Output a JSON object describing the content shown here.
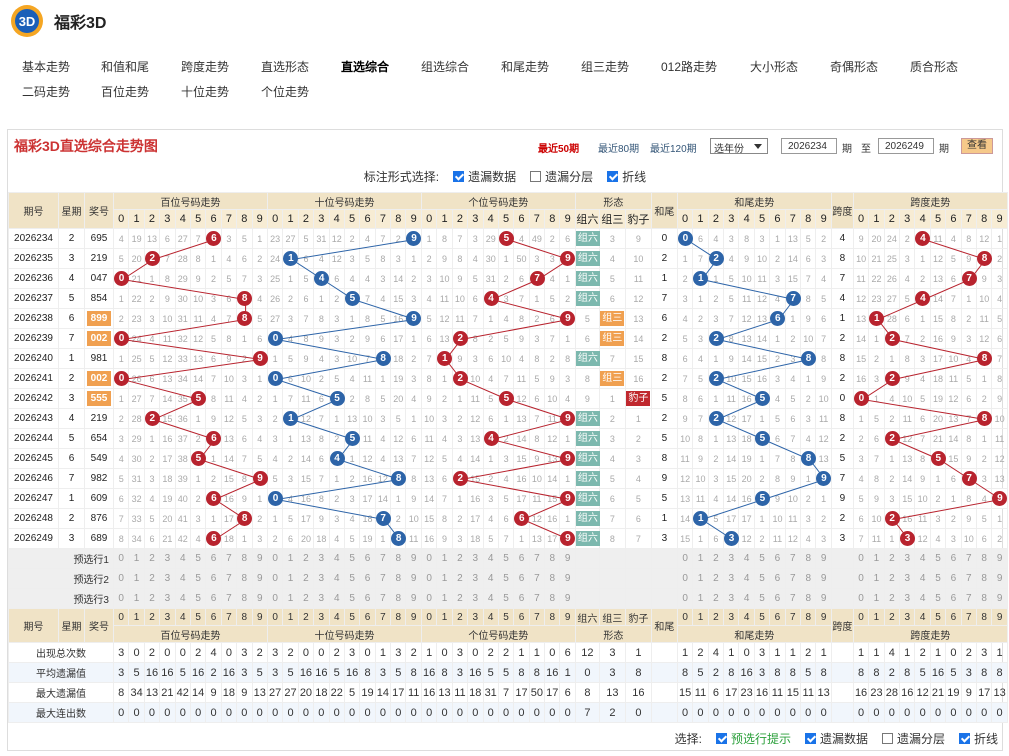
{
  "app": {
    "title": "福彩3D",
    "logo": "3D-logo"
  },
  "nav": {
    "row1": [
      "基本走势",
      "和值和尾",
      "跨度走势",
      "直选形态",
      "直选综合",
      "组选综合",
      "和尾走势",
      "组三走势",
      "012路走势",
      "大小形态",
      "奇偶形态",
      "质合形态"
    ],
    "row2": [
      "二码走势",
      "百位走势",
      "十位走势",
      "个位走势"
    ],
    "active": "直选综合"
  },
  "panel": {
    "title": "福彩3D直选综合走势图",
    "recent": [
      "最近50期",
      "最近80期",
      "最近120期"
    ],
    "year_select": "选年份",
    "from": "2026234",
    "to": "2026249",
    "qi": "期",
    "zhi": "至",
    "view_btn": "查看"
  },
  "mark_bar": {
    "label": "标注形式选择:",
    "opts": [
      {
        "t": "遗漏数据",
        "on": true
      },
      {
        "t": "遗漏分层",
        "on": false
      },
      {
        "t": "折线",
        "on": true
      }
    ]
  },
  "headers": {
    "qihao": "期号",
    "xingqi": "星期",
    "jianghao": "奖号",
    "bai": "百位号码走势",
    "shi": "十位号码走势",
    "ge": "个位号码走势",
    "xingtai": "形态",
    "zuliu": "组六",
    "zusan": "组三",
    "baozi": "豹子",
    "hewei": "和尾",
    "hezhi": "和尾走势",
    "kuadu": "跨度",
    "kuadu_zs": "跨度走势"
  },
  "rows": [
    {
      "q": "2026234",
      "w": "2",
      "n": "695",
      "b": [
        4,
        19,
        13,
        6,
        27,
        7,
        "6",
        3,
        5,
        1
      ],
      "s": [
        23,
        27,
        5,
        31,
        12,
        2,
        4,
        7,
        2,
        "9"
      ],
      "g": [
        1,
        8,
        7,
        3,
        29,
        "5",
        4,
        49,
        2,
        6
      ],
      "x": [
        "组六",
        3,
        9
      ],
      "hw": "0",
      "h": [
        "0",
        6,
        4,
        3,
        8,
        3,
        1,
        13,
        5,
        2
      ],
      "k": "4",
      "kd": [
        9,
        20,
        24,
        2,
        "4",
        11,
        4,
        8,
        12,
        1
      ]
    },
    {
      "q": "2026235",
      "w": "3",
      "n": "219",
      "b": [
        5,
        20,
        "2",
        7,
        28,
        8,
        1,
        4,
        6,
        2
      ],
      "s": [
        24,
        "1",
        6,
        4,
        12,
        3,
        5,
        8,
        3,
        1
      ],
      "g": [
        2,
        9,
        8,
        4,
        30,
        1,
        50,
        3,
        3,
        "9"
      ],
      "x": [
        "组六",
        4,
        10
      ],
      "hw": "2",
      "h": [
        1,
        7,
        "2",
        4,
        9,
        10,
        2,
        14,
        6,
        3
      ],
      "k": "8",
      "kd": [
        10,
        21,
        25,
        3,
        1,
        12,
        5,
        9,
        "8",
        2
      ]
    },
    {
      "q": "2026236",
      "w": "4",
      "n": "047",
      "b": [
        "0",
        21,
        1,
        8,
        29,
        9,
        2,
        5,
        7,
        3
      ],
      "s": [
        25,
        1,
        5,
        "4",
        6,
        4,
        4,
        3,
        14,
        2
      ],
      "g": [
        3,
        10,
        9,
        5,
        31,
        2,
        6,
        "7",
        4,
        1
      ],
      "x": [
        "组六",
        5,
        11
      ],
      "hw": "1",
      "h": [
        2,
        "1",
        1,
        5,
        10,
        11,
        3,
        15,
        7,
        4
      ],
      "k": "7",
      "kd": [
        11,
        22,
        26,
        4,
        2,
        13,
        6,
        "7",
        9,
        3
      ]
    },
    {
      "q": "2026237",
      "w": "5",
      "n": "854",
      "b": [
        1,
        22,
        2,
        9,
        30,
        10,
        3,
        6,
        "8",
        4
      ],
      "s": [
        26,
        2,
        6,
        1,
        2,
        "5",
        7,
        4,
        15,
        3
      ],
      "g": [
        4,
        11,
        10,
        6,
        "4",
        3,
        7,
        1,
        5,
        2
      ],
      "x": [
        "组六",
        6,
        12
      ],
      "hw": "7",
      "h": [
        3,
        1,
        2,
        5,
        11,
        12,
        4,
        "7",
        8,
        5
      ],
      "k": "4",
      "kd": [
        12,
        23,
        27,
        5,
        "4",
        14,
        7,
        1,
        10,
        4
      ]
    },
    {
      "q": "2026238",
      "w": "6",
      "n": "899",
      "b": [
        2,
        23,
        3,
        10,
        31,
        11,
        4,
        7,
        "8",
        5
      ],
      "s": [
        27,
        3,
        7,
        8,
        3,
        1,
        8,
        5,
        16,
        "9"
      ],
      "g": [
        5,
        12,
        11,
        7,
        1,
        4,
        8,
        2,
        6,
        "9"
      ],
      "x": [
        5,
        "组三",
        13
      ],
      "hw": "6",
      "h": [
        4,
        2,
        3,
        7,
        12,
        13,
        "6",
        1,
        9,
        6
      ],
      "k": "1",
      "kd": [
        13,
        "1",
        28,
        6,
        1,
        15,
        8,
        2,
        11,
        5
      ]
    },
    {
      "q": "2026239",
      "w": "7",
      "n": "002",
      "b": [
        "0",
        24,
        4,
        11,
        32,
        12,
        5,
        8,
        1,
        6
      ],
      "s": [
        "0",
        4,
        8,
        9,
        3,
        2,
        9,
        6,
        17,
        1
      ],
      "g": [
        6,
        13,
        "2",
        8,
        2,
        5,
        9,
        3,
        7,
        1
      ],
      "x": [
        6,
        "组三",
        14
      ],
      "hw": "2",
      "h": [
        5,
        3,
        "2",
        8,
        13,
        14,
        1,
        2,
        10,
        7
      ],
      "k": "2",
      "kd": [
        14,
        1,
        "2",
        7,
        2,
        16,
        9,
        3,
        12,
        6
      ]
    },
    {
      "q": "2026240",
      "w": "1",
      "n": "981",
      "b": [
        1,
        25,
        5,
        12,
        33,
        13,
        6,
        9,
        2,
        "9"
      ],
      "s": [
        1,
        5,
        9,
        4,
        3,
        10,
        7,
        "8",
        18,
        2
      ],
      "g": [
        7,
        "1",
        9,
        3,
        6,
        10,
        4,
        8,
        2,
        8
      ],
      "x": [
        "组六",
        7,
        15
      ],
      "hw": "8",
      "h": [
        6,
        4,
        1,
        9,
        14,
        15,
        2,
        3,
        "8",
        8
      ],
      "k": "8",
      "kd": [
        15,
        2,
        1,
        8,
        3,
        17,
        10,
        4,
        "8",
        7
      ]
    },
    {
      "q": "2026241",
      "w": "2",
      "n": "002",
      "b": [
        "0",
        26,
        6,
        13,
        34,
        14,
        7,
        10,
        3,
        1
      ],
      "s": [
        "0",
        6,
        10,
        2,
        5,
        4,
        11,
        1,
        19,
        3
      ],
      "g": [
        8,
        1,
        "2",
        10,
        4,
        7,
        11,
        5,
        9,
        3
      ],
      "x": [
        8,
        "组三",
        16
      ],
      "hw": "2",
      "h": [
        7,
        5,
        "2",
        10,
        15,
        16,
        3,
        4,
        1,
        9
      ],
      "k": "2",
      "kd": [
        16,
        3,
        "2",
        9,
        4,
        18,
        11,
        5,
        1,
        8
      ]
    },
    {
      "q": "2026242",
      "w": "3",
      "n": "555",
      "b": [
        1,
        27,
        7,
        14,
        35,
        "5",
        8,
        11,
        4,
        2
      ],
      "s": [
        1,
        7,
        11,
        6,
        "5",
        2,
        8,
        5,
        20,
        4
      ],
      "g": [
        9,
        2,
        1,
        11,
        5,
        "5",
        12,
        6,
        10,
        4
      ],
      "x": [
        9,
        1,
        "豹子"
      ],
      "hw": "5",
      "h": [
        8,
        6,
        1,
        11,
        16,
        "5",
        4,
        5,
        2,
        10
      ],
      "k": "0",
      "kd": [
        "0",
        1,
        4,
        10,
        5,
        19,
        12,
        6,
        2,
        9
      ]
    },
    {
      "q": "2026243",
      "w": "4",
      "n": "219",
      "b": [
        2,
        28,
        "2",
        15,
        36,
        1,
        9,
        12,
        5,
        3
      ],
      "s": [
        2,
        "1",
        12,
        7,
        1,
        13,
        10,
        3,
        5,
        1
      ],
      "g": [
        10,
        3,
        2,
        12,
        6,
        1,
        13,
        7,
        11,
        "9"
      ],
      "x": [
        "组六",
        2,
        1
      ],
      "hw": "2",
      "h": [
        9,
        7,
        "2",
        12,
        17,
        1,
        5,
        6,
        3,
        11
      ],
      "k": "8",
      "kd": [
        1,
        5,
        2,
        11,
        6,
        20,
        13,
        7,
        "8",
        10
      ]
    },
    {
      "q": "2026244",
      "w": "5",
      "n": "654",
      "b": [
        3,
        29,
        1,
        16,
        37,
        2,
        "6",
        13,
        6,
        4
      ],
      "s": [
        3,
        1,
        13,
        8,
        2,
        "5",
        11,
        4,
        12,
        6
      ],
      "g": [
        11,
        4,
        3,
        13,
        "4",
        2,
        14,
        8,
        12,
        1
      ],
      "x": [
        "组六",
        3,
        2
      ],
      "hw": "5",
      "h": [
        10,
        8,
        1,
        13,
        18,
        "5",
        6,
        7,
        4,
        12
      ],
      "k": "2",
      "kd": [
        2,
        6,
        "2",
        12,
        7,
        21,
        14,
        8,
        1,
        11
      ]
    },
    {
      "q": "2026245",
      "w": "6",
      "n": "549",
      "b": [
        4,
        30,
        2,
        17,
        38,
        "5",
        1,
        14,
        7,
        5
      ],
      "s": [
        4,
        2,
        14,
        6,
        "4",
        1,
        12,
        4,
        13,
        7
      ],
      "g": [
        12,
        5,
        4,
        14,
        1,
        3,
        15,
        9,
        13,
        "9"
      ],
      "x": [
        "组六",
        4,
        3
      ],
      "hw": "8",
      "h": [
        11,
        9,
        2,
        14,
        19,
        1,
        7,
        8,
        "8",
        13
      ],
      "k": "5",
      "kd": [
        3,
        7,
        1,
        13,
        8,
        "5",
        15,
        9,
        2,
        12
      ]
    },
    {
      "q": "2026246",
      "w": "7",
      "n": "982",
      "b": [
        5,
        31,
        3,
        18,
        39,
        1,
        2,
        15,
        8,
        "9"
      ],
      "s": [
        5,
        3,
        15,
        7,
        1,
        2,
        16,
        12,
        "8",
        8
      ],
      "g": [
        13,
        6,
        "2",
        15,
        2,
        4,
        16,
        10,
        14,
        1
      ],
      "x": [
        "组六",
        5,
        4
      ],
      "hw": "9",
      "h": [
        12,
        10,
        3,
        15,
        20,
        2,
        8,
        9,
        1,
        "9"
      ],
      "k": "7",
      "kd": [
        4,
        8,
        2,
        14,
        9,
        1,
        6,
        "7",
        3,
        13
      ]
    },
    {
      "q": "2026247",
      "w": "1",
      "n": "609",
      "b": [
        6,
        32,
        4,
        19,
        40,
        2,
        "6",
        16,
        9,
        1
      ],
      "s": [
        "0",
        4,
        16,
        8,
        2,
        3,
        17,
        14,
        1,
        9
      ],
      "g": [
        14,
        7,
        1,
        16,
        3,
        5,
        17,
        11,
        15,
        "9"
      ],
      "x": [
        "组六",
        6,
        5
      ],
      "hw": "5",
      "h": [
        13,
        11,
        4,
        14,
        16,
        "5",
        9,
        10,
        2,
        1
      ],
      "k": "9",
      "kd": [
        5,
        9,
        3,
        15,
        10,
        2,
        1,
        8,
        4,
        "9"
      ]
    },
    {
      "q": "2026248",
      "w": "2",
      "n": "876",
      "b": [
        7,
        33,
        5,
        20,
        41,
        3,
        1,
        17,
        "8",
        2
      ],
      "s": [
        1,
        5,
        17,
        9,
        3,
        4,
        18,
        "7",
        2,
        10
      ],
      "g": [
        15,
        8,
        2,
        17,
        4,
        6,
        "6",
        12,
        16,
        1
      ],
      "x": [
        "组六",
        7,
        6
      ],
      "hw": "1",
      "h": [
        14,
        "1",
        5,
        17,
        17,
        1,
        10,
        11,
        3,
        2
      ],
      "k": "2",
      "kd": [
        6,
        10,
        "2",
        16,
        11,
        3,
        2,
        9,
        5,
        1
      ]
    },
    {
      "q": "2026249",
      "w": "3",
      "n": "689",
      "b": [
        8,
        34,
        6,
        21,
        42,
        4,
        "6",
        18,
        1,
        3
      ],
      "s": [
        2,
        6,
        20,
        18,
        4,
        5,
        19,
        1,
        "8",
        11
      ],
      "g": [
        16,
        9,
        3,
        18,
        5,
        7,
        1,
        13,
        17,
        "9"
      ],
      "x": [
        "组六",
        8,
        7
      ],
      "hw": "3",
      "h": [
        15,
        1,
        6,
        "3",
        12,
        2,
        11,
        12,
        4,
        3
      ],
      "k": "3",
      "kd": [
        7,
        11,
        1,
        "3",
        12,
        4,
        3,
        10,
        6,
        2
      ]
    }
  ],
  "pre_labels": [
    "预选行1",
    "预选行2",
    "预选行3"
  ],
  "stats": {
    "labels": [
      "出现总次数",
      "平均遗漏值",
      "最大遗漏值",
      "最大连出数"
    ],
    "b": [
      [
        3,
        0,
        2,
        0,
        0,
        2,
        4,
        0,
        3,
        2
      ],
      [
        3,
        5,
        16,
        16,
        5,
        16,
        2,
        16,
        3,
        5
      ],
      [
        8,
        34,
        13,
        21,
        42,
        14,
        9,
        18,
        9,
        13
      ],
      [
        0,
        0,
        0,
        0,
        0,
        0,
        0,
        0,
        0,
        0
      ]
    ],
    "s": [
      [
        3,
        2,
        0,
        0,
        2,
        3,
        0,
        1,
        3,
        2
      ],
      [
        3,
        5,
        16,
        16,
        5,
        16,
        8,
        3,
        5,
        8
      ],
      [
        27,
        27,
        20,
        18,
        22,
        5,
        19,
        14,
        17,
        11
      ],
      [
        0,
        0,
        0,
        0,
        0,
        0,
        0,
        0,
        0,
        0
      ]
    ],
    "g": [
      [
        1,
        0,
        3,
        0,
        2,
        2,
        1,
        1,
        0,
        6
      ],
      [
        16,
        8,
        3,
        16,
        5,
        5,
        8,
        8,
        16,
        1
      ],
      [
        16,
        13,
        11,
        18,
        31,
        7,
        17,
        50,
        17,
        6
      ],
      [
        0,
        0,
        0,
        0,
        0,
        0,
        0,
        0,
        0,
        0
      ]
    ],
    "x": [
      [
        12,
        3,
        1
      ],
      [
        0,
        3,
        8
      ],
      [
        8,
        13,
        16
      ],
      [
        7,
        2,
        0
      ]
    ],
    "h": [
      [
        1,
        2,
        4,
        1,
        0,
        3,
        1,
        1,
        2,
        1
      ],
      [
        8,
        5,
        2,
        8,
        16,
        3,
        8,
        8,
        5,
        8
      ],
      [
        15,
        11,
        6,
        17,
        23,
        16,
        11,
        15,
        11,
        13
      ],
      [
        0,
        0,
        0,
        0,
        0,
        0,
        0,
        0,
        0,
        0
      ]
    ],
    "kd": [
      [
        1,
        1,
        4,
        1,
        2,
        1,
        0,
        2,
        3,
        1
      ],
      [
        8,
        8,
        2,
        8,
        5,
        16,
        5,
        3,
        8,
        8
      ],
      [
        16,
        23,
        28,
        16,
        12,
        21,
        19,
        9,
        17,
        13
      ],
      [
        0,
        0,
        0,
        0,
        0,
        0,
        0,
        0,
        0,
        0
      ]
    ]
  },
  "bottom": {
    "label": "选择:",
    "opts": [
      {
        "t": "预选行提示",
        "on": true,
        "g": true
      },
      {
        "t": "遗漏数据",
        "on": true
      },
      {
        "t": "遗漏分层",
        "on": false
      },
      {
        "t": "折线",
        "on": true
      }
    ]
  },
  "colors": {
    "red_ball": "#b8232e",
    "blue_ball": "#2d64a8",
    "zuliu": "#7cb8ae",
    "zusan": "#f0a050",
    "baozi": "#c0282e",
    "title": "#cc3333"
  }
}
